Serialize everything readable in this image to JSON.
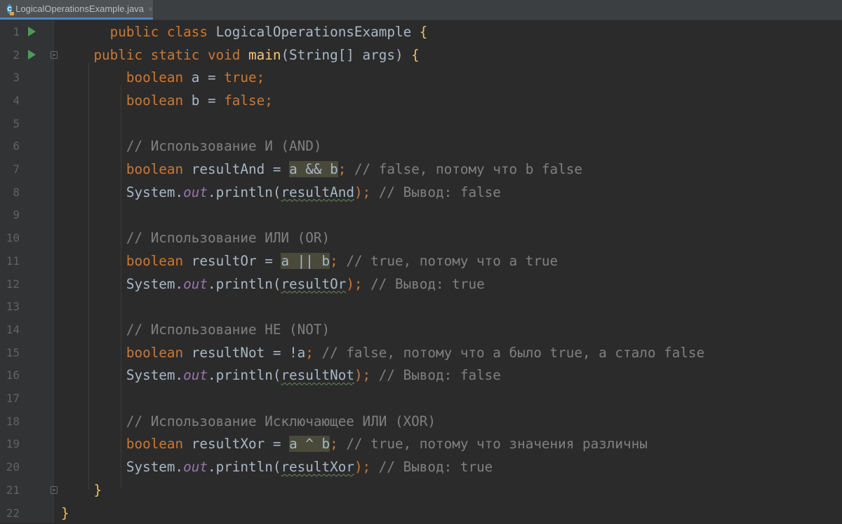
{
  "tab": {
    "filename": "LogicalOperationsExample.java",
    "close": "×",
    "icon": "java-class-icon",
    "icon_letter": "C"
  },
  "lines": [
    {
      "n": "1",
      "run": true
    },
    {
      "n": "2",
      "run": true
    },
    {
      "n": "3"
    },
    {
      "n": "4"
    },
    {
      "n": "5"
    },
    {
      "n": "6"
    },
    {
      "n": "7"
    },
    {
      "n": "8"
    },
    {
      "n": "9"
    },
    {
      "n": "10"
    },
    {
      "n": "11"
    },
    {
      "n": "12"
    },
    {
      "n": "13"
    },
    {
      "n": "14"
    },
    {
      "n": "15"
    },
    {
      "n": "16"
    },
    {
      "n": "17"
    },
    {
      "n": "18"
    },
    {
      "n": "19"
    },
    {
      "n": "20"
    },
    {
      "n": "21"
    },
    {
      "n": "22"
    }
  ],
  "code": {
    "l1": {
      "kw": "public class ",
      "name": "LogicalOperationsExample ",
      "brace": "{"
    },
    "l2": {
      "kw": "public static void ",
      "fn": "main",
      "rest": "(String[] args) ",
      "brace": "{"
    },
    "l3": {
      "kw": "boolean ",
      "var": "a = ",
      "val": "true;"
    },
    "l4": {
      "kw": "boolean ",
      "var": "b = ",
      "val": "false;"
    },
    "l6": "// Использование И (AND)",
    "l7": {
      "kw": "boolean ",
      "var": "resultAnd = ",
      "expr": "a && b",
      "semi": ";",
      "comment": " // false, потому что b false"
    },
    "l8": {
      "sys": "System.",
      "out": "out",
      "call": ".println(",
      "arg": "resultAnd",
      "close": ");",
      "comment": " // Вывод: false"
    },
    "l10": "// Использование ИЛИ (OR)",
    "l11": {
      "kw": "boolean ",
      "var": "resultOr = ",
      "expr": "a || b",
      "semi": ";",
      "comment": " // true, потому что a true"
    },
    "l12": {
      "sys": "System.",
      "out": "out",
      "call": ".println(",
      "arg": "resultOr",
      "close": ");",
      "comment": " // Вывод: true"
    },
    "l14": "// Использование НЕ (NOT)",
    "l15": {
      "kw": "boolean ",
      "var": "resultNot = ",
      "expr": "!a",
      "semi": ";",
      "comment": " // false, потому что a было true, а стало false"
    },
    "l16": {
      "sys": "System.",
      "out": "out",
      "call": ".println(",
      "arg": "resultNot",
      "close": ");",
      "comment": " // Вывод: false"
    },
    "l18": "// Использование Исключающее ИЛИ (XOR)",
    "l19": {
      "kw": "boolean ",
      "var": "resultXor = ",
      "expr": "a ^ b",
      "semi": ";",
      "comment": " // true, потому что значения различны"
    },
    "l20": {
      "sys": "System.",
      "out": "out",
      "call": ".println(",
      "arg": "resultXor",
      "close": ");",
      "comment": " // Вывод: true"
    },
    "l21": "}",
    "l22": "}"
  },
  "colors": {
    "background": "#2b2b2b",
    "keyword": "#cc7832",
    "method": "#ffc66d",
    "comment": "#808080",
    "static_field": "#9876aa",
    "text": "#a9b7c6",
    "run_icon": "#499c54"
  }
}
